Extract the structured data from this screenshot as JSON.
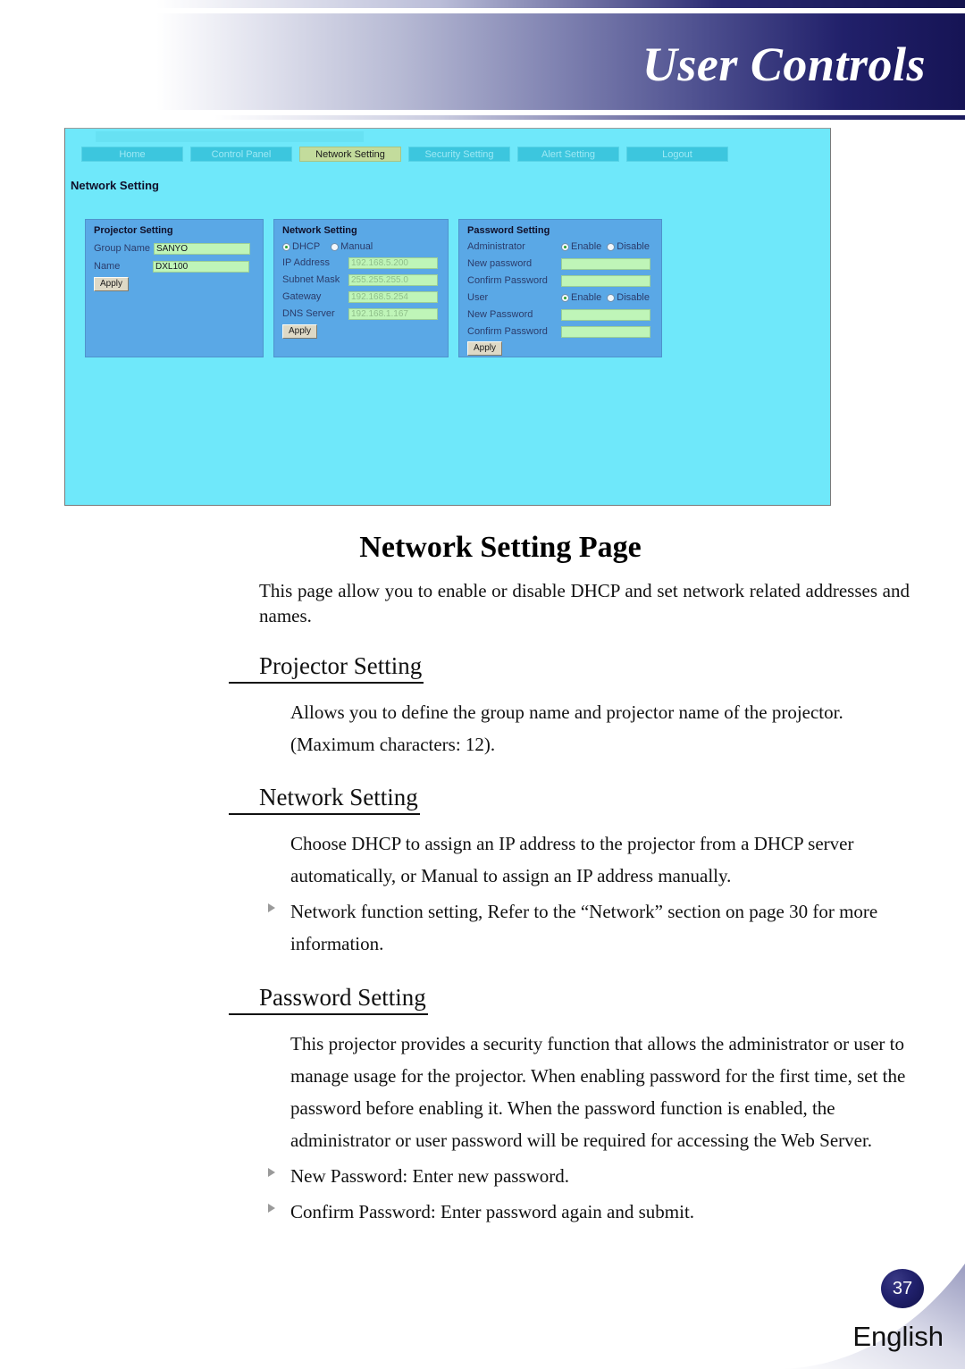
{
  "header": {
    "title": "User Controls"
  },
  "screenshot": {
    "page_heading": "Network Setting",
    "nav_tabs": [
      {
        "label": "Home",
        "active": false
      },
      {
        "label": "Control Panel",
        "active": false
      },
      {
        "label": "Network Setting",
        "active": true
      },
      {
        "label": "Security Setting",
        "active": false
      },
      {
        "label": "Alert Setting",
        "active": false
      },
      {
        "label": "Logout",
        "active": false
      }
    ],
    "projector_panel": {
      "title": "Projector Setting",
      "group_name_label": "Group Name",
      "group_name_value": "SANYO",
      "name_label": "Name",
      "name_value": "DXL100",
      "apply_label": "Apply"
    },
    "network_panel": {
      "title": "Network Setting",
      "dhcp_label": "DHCP",
      "manual_label": "Manual",
      "ip_label": "IP Address",
      "ip_value": "192.168.5.200",
      "subnet_label": "Subnet Mask",
      "subnet_value": "255.255.255.0",
      "gateway_label": "Gateway",
      "gateway_value": "192.168.5.254",
      "dns_label": "DNS Server",
      "dns_value": "192.168.1.167",
      "apply_label": "Apply"
    },
    "password_panel": {
      "title": "Password Setting",
      "administrator_label": "Administrator",
      "admin_enable_label": "Enable",
      "admin_disable_label": "Disable",
      "admin_new_password_label": "New password",
      "admin_new_password_value": "",
      "admin_confirm_label": "Confirm Password",
      "admin_confirm_value": "",
      "user_label": "User",
      "user_enable_label": "Enable",
      "user_disable_label": "Disable",
      "user_new_password_label": "New Password",
      "user_new_password_value": "",
      "user_confirm_label": "Confirm Password",
      "user_confirm_value": "",
      "apply_label": "Apply"
    },
    "colors": {
      "page_background": "#6fe8fa",
      "panel_background": "#5aa8e6",
      "tab_background": "#3cc6de",
      "tab_active_background": "#c3dc9c",
      "textbox_background": "#bff5b8"
    }
  },
  "document": {
    "title": "Network Setting Page",
    "intro": "This page allow you to enable or disable DHCP and set network related addresses and names.",
    "sections": [
      {
        "heading": "Projector Setting",
        "paragraphs": [
          "Allows you to define the group name and projector name of the projector. (Maximum characters: 12)."
        ],
        "bullets": []
      },
      {
        "heading": "Network Setting",
        "paragraphs": [
          "Choose DHCP to assign an IP address to the projector from a DHCP server automatically, or Manual to assign an IP address manually."
        ],
        "bullets": [
          "Network function setting, Refer to the “Network” section on page 30 for more information."
        ]
      },
      {
        "heading": "Password Setting",
        "paragraphs": [
          "This projector provides a security function that allows the administrator or user to manage usage for the projector. When enabling password for the first time, set the password before enabling it. When the password function is enabled, the administrator or user password will be required for accessing the Web Server."
        ],
        "bullets": [
          "New Password: Enter new password.",
          "Confirm Password: Enter password again and submit."
        ]
      }
    ]
  },
  "footer": {
    "page_number": "37",
    "language": "English"
  }
}
